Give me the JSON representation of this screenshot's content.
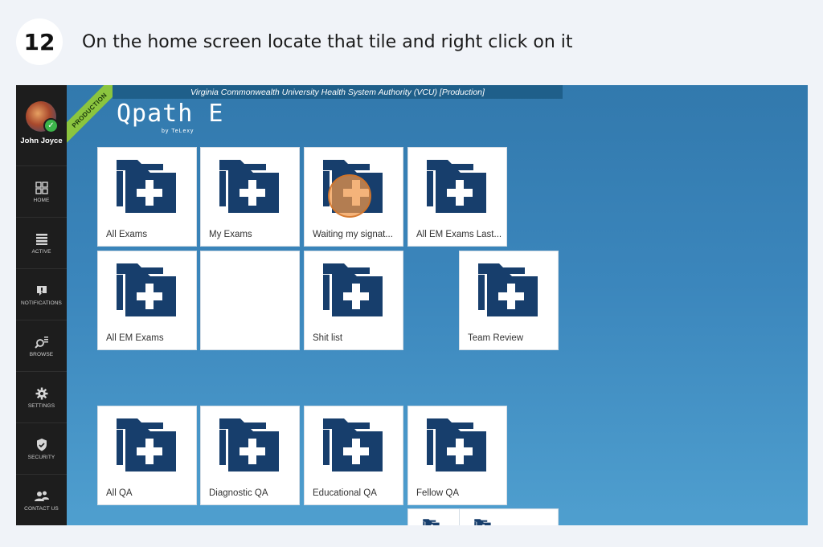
{
  "step": {
    "number": "12",
    "instruction": "On the home screen locate that tile and right click on it"
  },
  "app": {
    "org_banner": "Virginia Commonwealth University Health System Authority (VCU) [Production]",
    "environment_ribbon": "PRODUCTION",
    "logo_text": "Qpath E",
    "logo_sub": "by TeLexy",
    "user_name": "John Joyce"
  },
  "sidebar": {
    "items": [
      {
        "label": "HOME",
        "icon": "home-grid-icon"
      },
      {
        "label": "ACTIVE",
        "icon": "list-icon"
      },
      {
        "label": "NOTIFICATIONS",
        "icon": "alert-icon"
      },
      {
        "label": "BROWSE",
        "icon": "search-icon"
      },
      {
        "label": "SETTINGS",
        "icon": "gear-icon"
      },
      {
        "label": "SECURITY",
        "icon": "shield-icon"
      },
      {
        "label": "CONTACT US",
        "icon": "contacts-icon"
      }
    ]
  },
  "tiles": [
    {
      "label": "All Exams",
      "icon": "folder-plus-icon"
    },
    {
      "label": "My Exams",
      "icon": "folder-plus-icon"
    },
    {
      "label": "Waiting my signat...",
      "icon": "folder-plus-icon",
      "highlighted": true
    },
    {
      "label": "All EM Exams Last...",
      "icon": "folder-plus-icon"
    },
    {
      "label": "All EM Exams",
      "icon": "folder-plus-icon"
    },
    {
      "label": "",
      "icon": ""
    },
    {
      "label": "Shit list",
      "icon": "folder-plus-icon"
    },
    {
      "label": "Team Review",
      "icon": "folder-plus-icon"
    },
    {
      "label": "All QA",
      "icon": "folder-plus-icon"
    },
    {
      "label": "Diagnostic QA",
      "icon": "folder-plus-icon"
    },
    {
      "label": "Educational QA",
      "icon": "folder-plus-icon"
    },
    {
      "label": "Fellow QA",
      "icon": "folder-plus-icon"
    }
  ],
  "colors": {
    "background": "#f0f3f8",
    "sidebar": "#1d1d1d",
    "app_blue": "#3b86bc",
    "folder_icon": "#173e6c",
    "production_ribbon": "#8bc53f",
    "cursor_highlight": "#f09646"
  }
}
